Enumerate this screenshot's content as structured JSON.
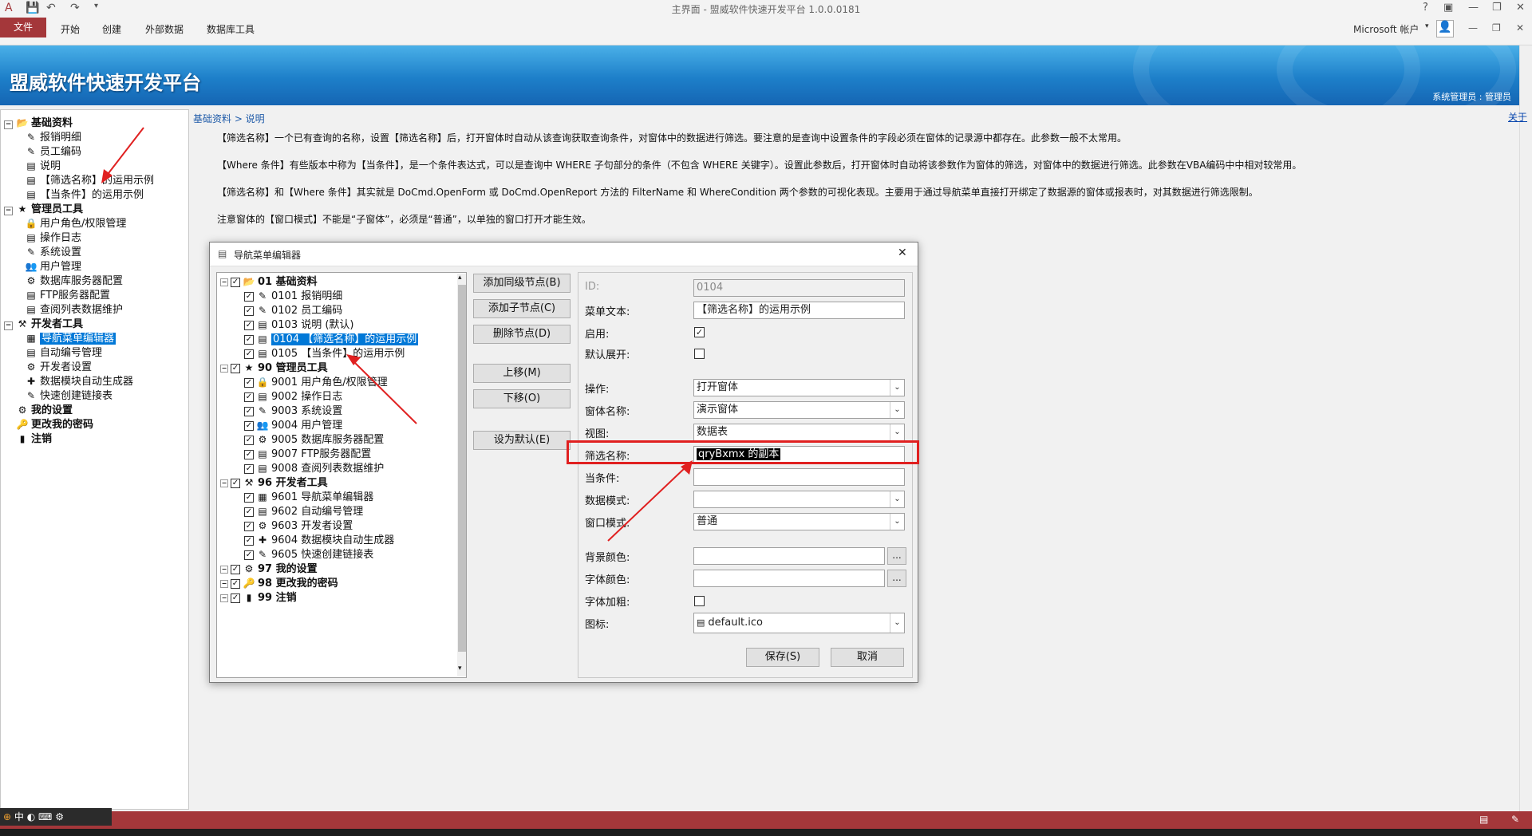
{
  "window": {
    "title": "主界面 - 盟威软件快速开发平台  1.0.0.0181",
    "account": "Microsoft 帐户",
    "help": "?"
  },
  "ribbon": {
    "tabs": [
      "文件",
      "开始",
      "创建",
      "外部数据",
      "数据库工具"
    ]
  },
  "banner": {
    "app_title": "盟威软件快速开发平台",
    "user_info": "系统管理员 : 管理员"
  },
  "sidebar": {
    "items": [
      {
        "label": "基础资料",
        "level": 0,
        "icon": "📂",
        "toggle": "−"
      },
      {
        "label": "报销明细",
        "level": 1,
        "icon": "✎"
      },
      {
        "label": "员工编码",
        "level": 1,
        "icon": "✎"
      },
      {
        "label": "说明",
        "level": 1,
        "icon": "▤"
      },
      {
        "label": "【筛选名称】的运用示例",
        "level": 1,
        "icon": "▤"
      },
      {
        "label": "【当条件】的运用示例",
        "level": 1,
        "icon": "▤"
      },
      {
        "label": "管理员工具",
        "level": 0,
        "icon": "★",
        "toggle": "−"
      },
      {
        "label": "用户角色/权限管理",
        "level": 1,
        "icon": "🔒"
      },
      {
        "label": "操作日志",
        "level": 1,
        "icon": "▤"
      },
      {
        "label": "系统设置",
        "level": 1,
        "icon": "✎"
      },
      {
        "label": "用户管理",
        "level": 1,
        "icon": "👥"
      },
      {
        "label": "数据库服务器配置",
        "level": 1,
        "icon": "⚙"
      },
      {
        "label": "FTP服务器配置",
        "level": 1,
        "icon": "▤"
      },
      {
        "label": "查阅列表数据维护",
        "level": 1,
        "icon": "▤"
      },
      {
        "label": "开发者工具",
        "level": 0,
        "icon": "⚒",
        "toggle": "−"
      },
      {
        "label": "导航菜单编辑器",
        "level": 1,
        "icon": "▦",
        "selected": true
      },
      {
        "label": "自动编号管理",
        "level": 1,
        "icon": "▤"
      },
      {
        "label": "开发者设置",
        "level": 1,
        "icon": "⚙"
      },
      {
        "label": "数据模块自动生成器",
        "level": 1,
        "icon": "✚"
      },
      {
        "label": "快速创建链接表",
        "level": 1,
        "icon": "✎"
      },
      {
        "label": "我的设置",
        "level": 0,
        "icon": "⚙"
      },
      {
        "label": "更改我的密码",
        "level": 0,
        "icon": "🔑"
      },
      {
        "label": "注销",
        "level": 0,
        "icon": "▮"
      }
    ]
  },
  "content": {
    "breadcrumb": "基础资料 > 说明",
    "close_link": "关于",
    "paragraphs": [
      "【筛选名称】一个已有查询的名称，设置【筛选名称】后，打开窗体时自动从该查询获取查询条件，对窗体中的数据进行筛选。要注意的是查询中设置条件的字段必须在窗体的记录源中都存在。此参数一般不太常用。",
      "【Where 条件】有些版本中称为【当条件】，是一个条件表达式，可以是查询中 WHERE 子句部分的条件（不包含 WHERE 关键字）。设置此参数后，打开窗体时自动将该参数作为窗体的筛选，对窗体中的数据进行筛选。此参数在VBA编码中中相对较常用。",
      "【筛选名称】和【Where 条件】其实就是 DoCmd.OpenForm 或 DoCmd.OpenReport 方法的 FilterName 和 WhereCondition 两个参数的可视化表现。主要用于通过导航菜单直接打开绑定了数据源的窗体或报表时，对其数据进行筛选限制。",
      "注意窗体的【窗口模式】不能是“子窗体”，必须是“普通”，以单独的窗口打开才能生效。"
    ]
  },
  "dialog": {
    "title": "导航菜单编辑器",
    "close": "✕",
    "tree": [
      {
        "label": "01 基础资料",
        "group": true,
        "icon": "📂"
      },
      {
        "label": "0101 报销明细",
        "icon": "✎"
      },
      {
        "label": "0102 员工编码",
        "icon": "✎"
      },
      {
        "label": "0103 说明 (默认)",
        "icon": "▤"
      },
      {
        "label": "0104 【筛选名称】的运用示例",
        "icon": "▤",
        "selected": true
      },
      {
        "label": "0105 【当条件】的运用示例",
        "icon": "▤"
      },
      {
        "label": "90 管理员工具",
        "group": true,
        "icon": "★"
      },
      {
        "label": "9001 用户角色/权限管理",
        "icon": "🔒"
      },
      {
        "label": "9002 操作日志",
        "icon": "▤"
      },
      {
        "label": "9003 系统设置",
        "icon": "✎"
      },
      {
        "label": "9004 用户管理",
        "icon": "👥"
      },
      {
        "label": "9005 数据库服务器配置",
        "icon": "⚙"
      },
      {
        "label": "9007 FTP服务器配置",
        "icon": "▤"
      },
      {
        "label": "9008 查阅列表数据维护",
        "icon": "▤"
      },
      {
        "label": "96 开发者工具",
        "group": true,
        "icon": "⚒"
      },
      {
        "label": "9601 导航菜单编辑器",
        "icon": "▦"
      },
      {
        "label": "9602 自动编号管理",
        "icon": "▤"
      },
      {
        "label": "9603 开发者设置",
        "icon": "⚙"
      },
      {
        "label": "9604 数据模块自动生成器",
        "icon": "✚"
      },
      {
        "label": "9605 快速创建链接表",
        "icon": "✎"
      },
      {
        "label": "97 我的设置",
        "group": true,
        "icon": "⚙"
      },
      {
        "label": "98 更改我的密码",
        "group": true,
        "icon": "🔑"
      },
      {
        "label": "99 注销",
        "group": true,
        "icon": "▮"
      }
    ],
    "buttons": {
      "add_sibling": "添加同级节点(B)",
      "add_child": "添加子节点(C)",
      "delete": "删除节点(D)",
      "move_up": "上移(M)",
      "move_down": "下移(O)",
      "set_default": "设为默认(E)",
      "save": "保存(S)",
      "cancel": "取消"
    },
    "props": {
      "id_label": "ID:",
      "id_value": "0104",
      "text_label": "菜单文本:",
      "text_value": "【筛选名称】的运用示例",
      "enabled_label": "启用:",
      "enabled": true,
      "expand_label": "默认展开:",
      "expand": false,
      "op_label": "操作:",
      "op_value": "打开窗体",
      "form_label": "窗体名称:",
      "form_value": "演示窗体",
      "view_label": "视图:",
      "view_value": "数据表",
      "filter_label": "筛选名称:",
      "filter_value": "qryBxmx 的副本",
      "where_label": "当条件:",
      "where_value": "",
      "data_label": "数据模式:",
      "data_value": "",
      "win_label": "窗口模式:",
      "win_value": "普通",
      "bg_label": "背景颜色:",
      "bg_value": "",
      "fg_label": "字体颜色:",
      "fg_value": "",
      "bold_label": "字体加粗:",
      "bold": false,
      "icon_label": "图标:",
      "icon_value": "default.ico",
      "dots": "..."
    }
  },
  "status": {
    "ime": "中"
  },
  "colors": {
    "accent": "#a4373a",
    "banner": "#1d7fc9",
    "selection": "#0078d7",
    "highlight": "#e02020"
  }
}
